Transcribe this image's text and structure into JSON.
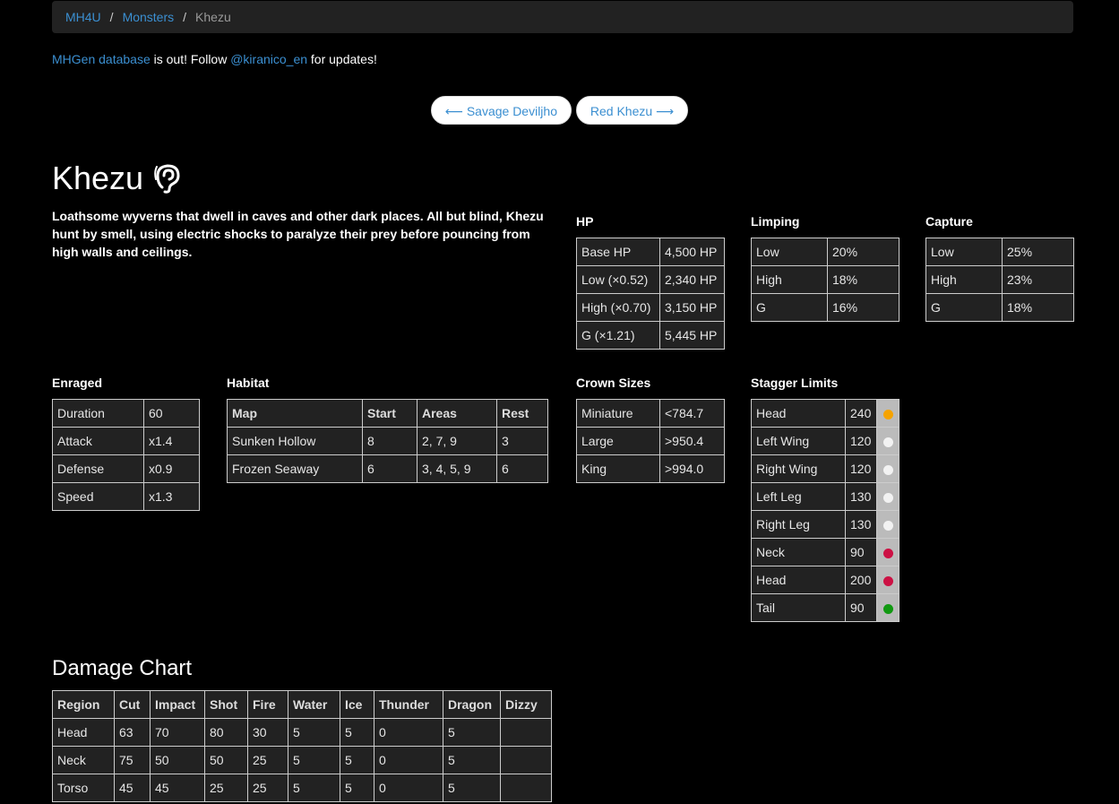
{
  "breadcrumb": {
    "root": "MH4U",
    "section": "Monsters",
    "current": "Khezu",
    "separator": "/"
  },
  "notice": {
    "link1": "MHGen database",
    "text1": " is out! Follow ",
    "link2": "@kiranico_en",
    "text2": " for updates!"
  },
  "pager": {
    "prev": "⟵ Savage Deviljho",
    "next": "Red Khezu ⟶"
  },
  "monster": {
    "name": "Khezu",
    "icon": "ear-icon",
    "description": "Loathsome wyverns that dwell in caves and other dark places. All but blind, Khezu hunt by smell, using electric shocks to paralyze their prey before pouncing from high walls and ceilings."
  },
  "hp": {
    "title": "HP",
    "rows": [
      [
        "Base HP",
        "4,500 HP"
      ],
      [
        "Low (×0.52)",
        "2,340 HP"
      ],
      [
        "High (×0.70)",
        "3,150 HP"
      ],
      [
        "G (×1.21)",
        "5,445 HP"
      ]
    ]
  },
  "limping": {
    "title": "Limping",
    "rows": [
      [
        "Low",
        "20%"
      ],
      [
        "High",
        "18%"
      ],
      [
        "G",
        "16%"
      ]
    ]
  },
  "capture": {
    "title": "Capture",
    "rows": [
      [
        "Low",
        "25%"
      ],
      [
        "High",
        "23%"
      ],
      [
        "G",
        "18%"
      ]
    ]
  },
  "enraged": {
    "title": "Enraged",
    "rows": [
      [
        "Duration",
        "60"
      ],
      [
        "Attack",
        "x1.4"
      ],
      [
        "Defense",
        "x0.9"
      ],
      [
        "Speed",
        "x1.3"
      ]
    ]
  },
  "habitat": {
    "title": "Habitat",
    "headers": [
      "Map",
      "Start",
      "Areas",
      "Rest"
    ],
    "rows": [
      [
        "Sunken Hollow",
        "8",
        "2, 7, 9",
        "3"
      ],
      [
        "Frozen Seaway",
        "6",
        "3, 4, 5, 9",
        "6"
      ]
    ]
  },
  "crown": {
    "title": "Crown Sizes",
    "rows": [
      [
        "Miniature",
        "<784.7"
      ],
      [
        "Large",
        ">950.4"
      ],
      [
        "King",
        ">994.0"
      ]
    ]
  },
  "stagger": {
    "title": "Stagger Limits",
    "rows": [
      [
        "Head",
        "240",
        "#f5a300"
      ],
      [
        "Left Wing",
        "120",
        "#f2f2f2"
      ],
      [
        "Right Wing",
        "120",
        "#f2f2f2"
      ],
      [
        "Left Leg",
        "130",
        "#f2f2f2"
      ],
      [
        "Right Leg",
        "130",
        "#f2f2f2"
      ],
      [
        "Neck",
        "90",
        "#cc1144"
      ],
      [
        "Head",
        "200",
        "#cc1144"
      ],
      [
        "Tail",
        "90",
        "#119911"
      ]
    ]
  },
  "damage": {
    "title": "Damage Chart",
    "headers": [
      "Region",
      "Cut",
      "Impact",
      "Shot",
      "Fire",
      "Water",
      "Ice",
      "Thunder",
      "Dragon",
      "Dizzy"
    ],
    "rows": [
      [
        "Head",
        "63",
        "70",
        "80",
        "30",
        "5",
        "5",
        "0",
        "5",
        ""
      ],
      [
        "Neck",
        "75",
        "50",
        "50",
        "25",
        "5",
        "5",
        "0",
        "5",
        ""
      ],
      [
        "Torso",
        "45",
        "45",
        "25",
        "25",
        "5",
        "5",
        "0",
        "5",
        ""
      ]
    ]
  }
}
